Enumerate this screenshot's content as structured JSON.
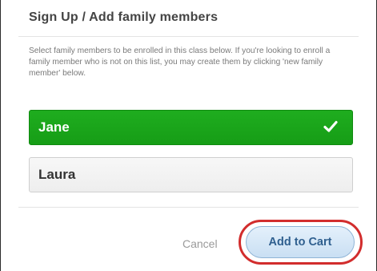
{
  "dialog": {
    "title": "Sign Up / Add family members",
    "instructions": "Select family members to be enrolled in this class below. If you're looking to enroll a family member who is not on this list, you may create them by clicking 'new family member' below."
  },
  "members": [
    {
      "name": "Jane",
      "selected": true,
      "icon": "checkmark-icon"
    },
    {
      "name": "Laura",
      "selected": false
    }
  ],
  "actions": {
    "cancel_label": "Cancel",
    "add_to_cart_label": "Add to Cart"
  },
  "colors": {
    "selected_green": "#1fad1f",
    "highlight_red": "#d22d2d",
    "button_blue": "#c9dff3"
  }
}
